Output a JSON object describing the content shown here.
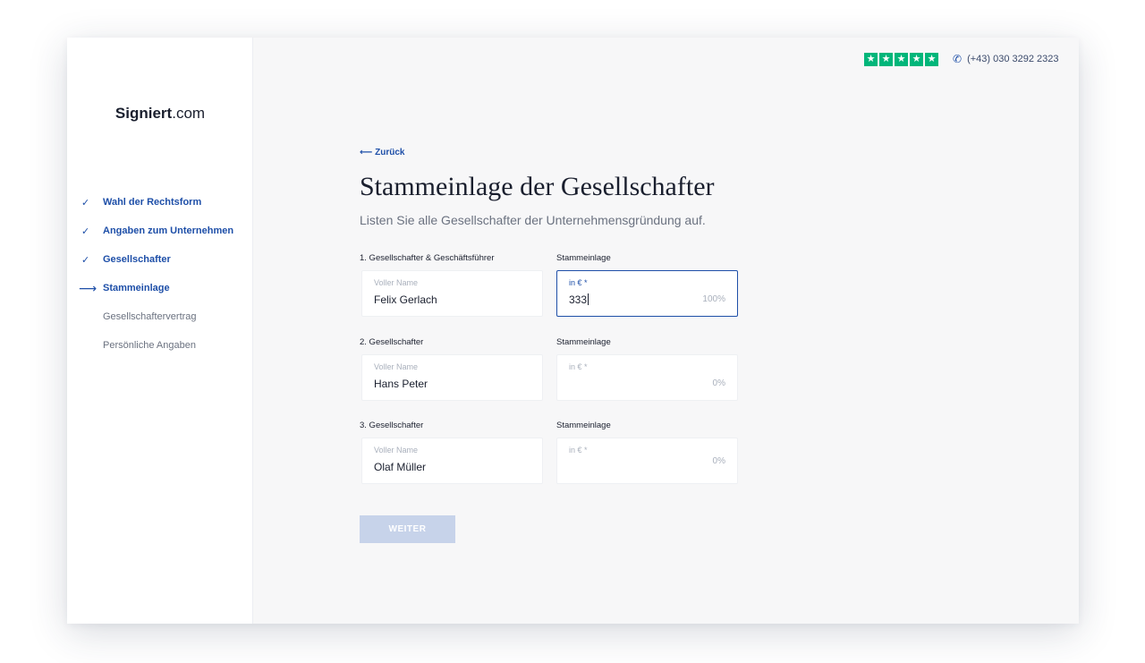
{
  "brand": {
    "bold": "Signiert",
    "rest": ".com"
  },
  "rating": {
    "stars": 5,
    "star_glyph": "★",
    "color": "#00b67a"
  },
  "contact": {
    "phone": "(+43) 030 3292 2323"
  },
  "steps": [
    {
      "label": "Wahl der Rechtsform",
      "state": "done",
      "mark": "✓"
    },
    {
      "label": "Angaben zum Unternehmen",
      "state": "done",
      "mark": "✓"
    },
    {
      "label": "Gesellschafter",
      "state": "done",
      "mark": "✓"
    },
    {
      "label": "Stammeinlage",
      "state": "active",
      "mark": "⟶"
    },
    {
      "label": "Gesellschaftervertrag",
      "state": "todo",
      "mark": ""
    },
    {
      "label": "Persönliche Angaben",
      "state": "todo",
      "mark": ""
    }
  ],
  "page": {
    "back": "⟵ Zurück",
    "title": "Stammeinlage der Gesellschafter",
    "subtitle": "Listen Sie alle Gesellschafter der Unternehmensgründung auf."
  },
  "partners": [
    {
      "heading": "1. Gesellschafter & Geschäftsführer",
      "contribution_heading": "Stammeinlage",
      "name_placeholder": "Voller Name",
      "name": "Felix Gerlach",
      "amount_placeholder": "in € *",
      "amount": "333",
      "percent": "100%",
      "focused": true
    },
    {
      "heading": "2. Gesellschafter",
      "contribution_heading": "Stammeinlage",
      "name_placeholder": "Voller Name",
      "name": "Hans Peter",
      "amount_placeholder": "in € *",
      "amount": "",
      "percent": "0%",
      "focused": false
    },
    {
      "heading": "3. Gesellschafter",
      "contribution_heading": "Stammeinlage",
      "name_placeholder": "Voller Name",
      "name": "Olaf Müller",
      "amount_placeholder": "in € *",
      "amount": "",
      "percent": "0%",
      "focused": false
    }
  ],
  "actions": {
    "next": "WEITER"
  },
  "colors": {
    "accent": "#1e4fa8",
    "button_disabled": "#c7d3ea"
  }
}
